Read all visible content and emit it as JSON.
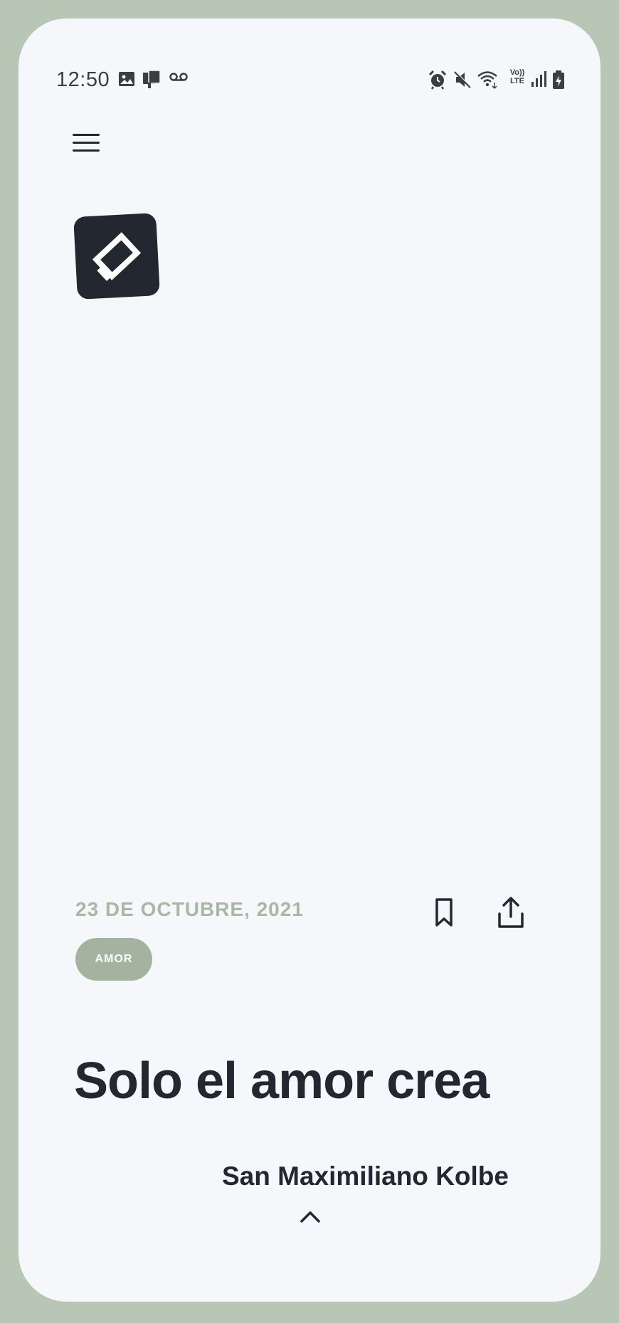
{
  "status_bar": {
    "time": "12:50",
    "left_icons": [
      "image-icon",
      "cast-icon",
      "voicemail-icon"
    ],
    "right_icons": [
      "alarm-icon",
      "mute-icon",
      "wifi-icon",
      "volte-icon",
      "signal-icon",
      "battery-icon"
    ],
    "volte_label_top": "Vo))",
    "volte_label_bottom": "LTE"
  },
  "header": {
    "menu_icon": "hamburger-menu-icon",
    "logo_icon": "app-logo-icon"
  },
  "article": {
    "date": "23 DE OCTUBRE, 2021",
    "tag": "AMOR",
    "title": "Solo el amor crea",
    "author": "San Maximiliano Kolbe"
  },
  "actions": {
    "bookmark_icon": "bookmark-icon",
    "share_icon": "share-icon",
    "expand_icon": "chevron-up-icon"
  },
  "colors": {
    "frame": "#b8c6b5",
    "background": "#f6f7fb",
    "text_dark": "#23272f",
    "date_accent": "#a9b8a5",
    "tag_bg": "#a3b3a0"
  }
}
